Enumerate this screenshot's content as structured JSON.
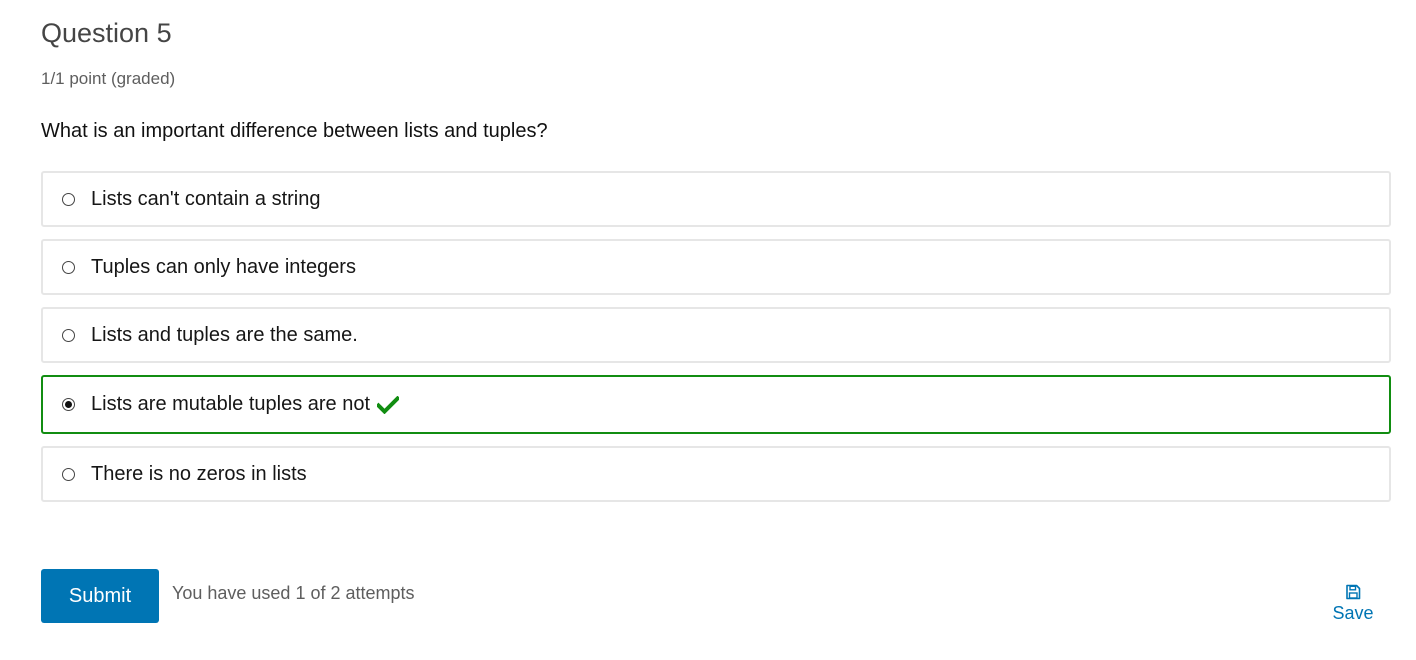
{
  "question": {
    "title": "Question 5",
    "grade": "1/1 point (graded)",
    "prompt": "What is an important difference between lists and tuples?"
  },
  "choices": [
    {
      "label": "Lists can't contain a string",
      "selected": false,
      "correct": false
    },
    {
      "label": "Tuples can only have integers",
      "selected": false,
      "correct": false
    },
    {
      "label": "Lists and tuples are the same.",
      "selected": false,
      "correct": false
    },
    {
      "label": "Lists are mutable tuples are not",
      "selected": true,
      "correct": true
    },
    {
      "label": "There is no zeros in lists",
      "selected": false,
      "correct": false
    }
  ],
  "actions": {
    "submit_label": "Submit",
    "attempts_text": "You have used 1 of 2 attempts",
    "save_label": "Save"
  },
  "icons": {
    "correct": "checkmark-icon",
    "save": "floppy-disk-icon"
  },
  "colors": {
    "accent": "#0075b4",
    "correct": "#118d11",
    "choice_border": "#e6e6e6"
  }
}
